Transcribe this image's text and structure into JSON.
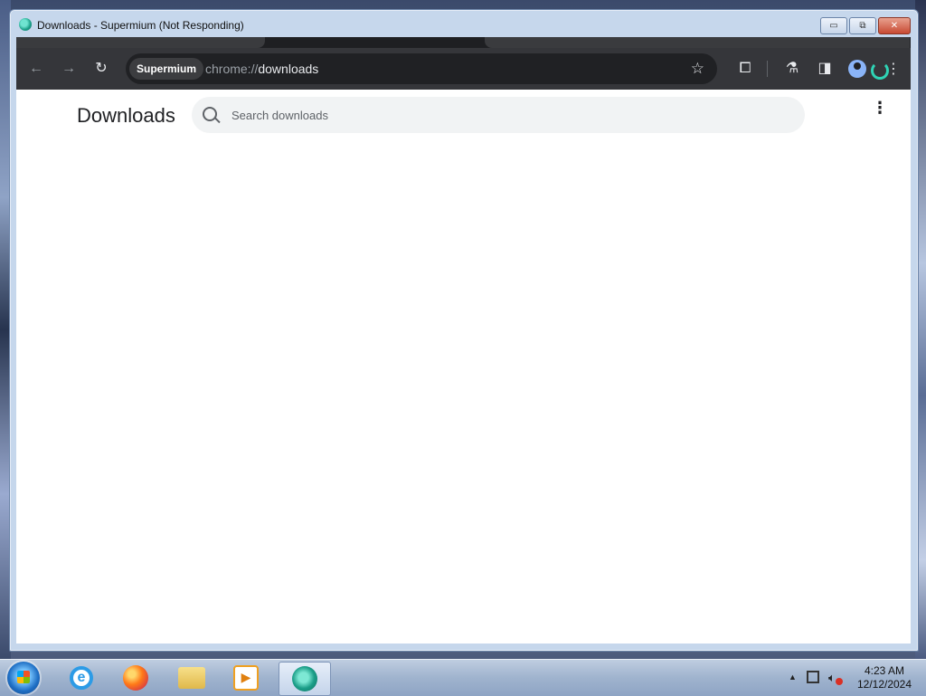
{
  "window": {
    "title": "Downloads - Supermium (Not Responding)",
    "controls": {
      "minimize": "▭",
      "maximize": "⧉",
      "close": "✕"
    }
  },
  "toolbar": {
    "back_icon": "arrow-left-icon",
    "forward_icon": "arrow-right-icon",
    "reload_icon": "reload-icon",
    "site_chip": "Supermium",
    "url_prefix": "chrome://",
    "url_path": "downloads",
    "bookmark_icon": "star-icon",
    "extensions_icon": "puzzle-icon",
    "labs_icon": "flask-icon",
    "sidepanel_icon": "side-panel-icon",
    "profile_icon": "profile-avatar-icon",
    "menu_icon": "kebab-menu-icon"
  },
  "page": {
    "title": "Downloads",
    "search": {
      "placeholder": "Search downloads",
      "value": ""
    },
    "menu_icon": "more-vertical-icon"
  },
  "taskbar": {
    "apps": [
      "start-orb",
      "internet-explorer",
      "firefox",
      "file-explorer",
      "media-player",
      "supermium"
    ],
    "active_app": "supermium",
    "clock": {
      "time": "4:23 AM",
      "date": "12/12/2024"
    }
  }
}
